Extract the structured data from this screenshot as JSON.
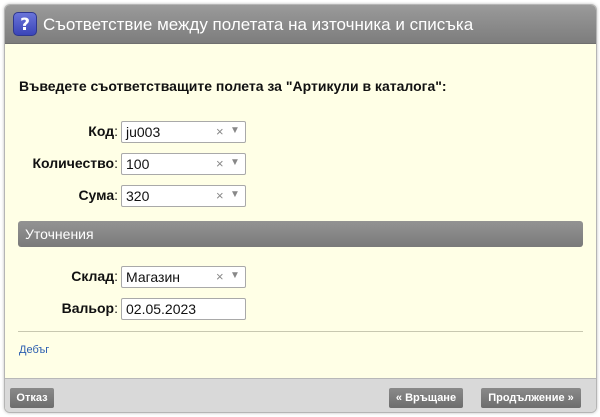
{
  "dialog": {
    "title": "Съответствие между полетата на източника и списъка",
    "help_icon_glyph": "?",
    "instruction": "Въведете съответстващите полета за \"Артикули в каталога\":"
  },
  "fields": [
    {
      "label": "Код",
      "value": "ju003"
    },
    {
      "label": "Количество",
      "value": "100"
    },
    {
      "label": "Сума",
      "value": "320"
    }
  ],
  "section": {
    "title": "Уточнения"
  },
  "extra_fields": {
    "warehouse": {
      "label": "Склад",
      "value": "Магазин"
    },
    "currency_date": {
      "label": "Вальор",
      "value": "02.05.2023"
    }
  },
  "select_controls": {
    "clear_glyph": "×",
    "dropdown_glyph": "▼"
  },
  "label_suffix": ":",
  "debug_link": "Дебъг",
  "footer": {
    "cancel": "Отказ",
    "back": "« Връщане",
    "continue": "Продължение »"
  }
}
